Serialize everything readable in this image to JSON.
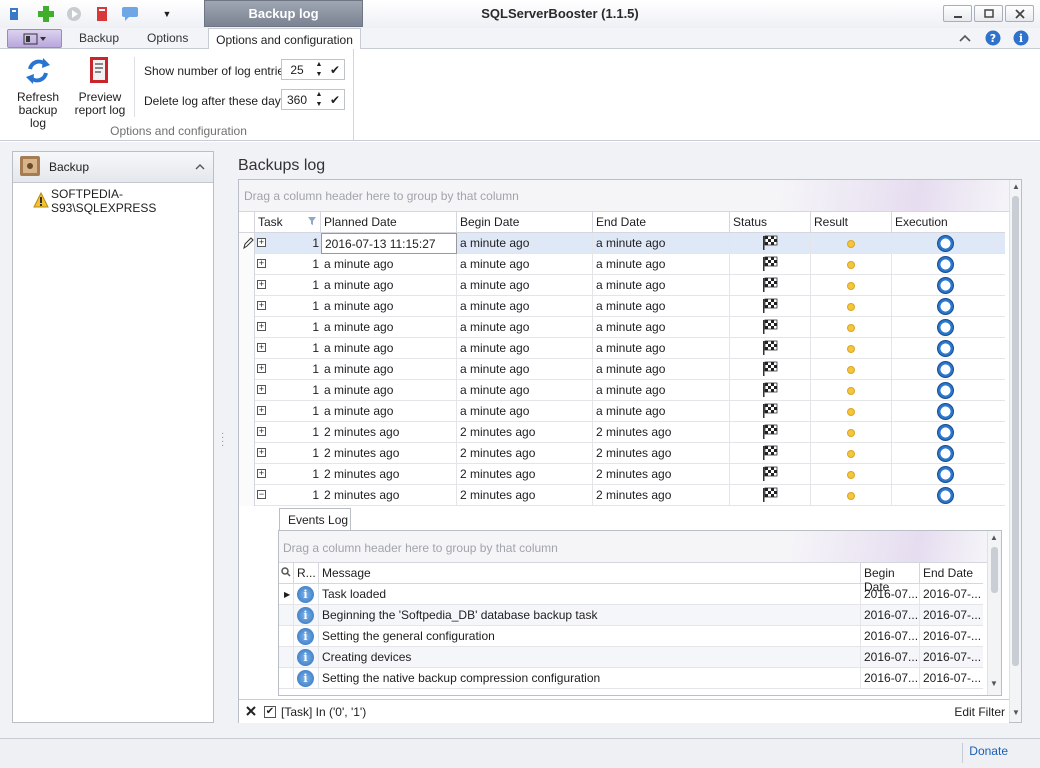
{
  "window": {
    "title": "SQLServerBooster (1.1.5)",
    "contextual_tab": "Backup log"
  },
  "ribbon": {
    "tabs": [
      "Backup",
      "Options"
    ],
    "active_tab": "Options and configuration",
    "buttons": {
      "refresh": "Refresh\nbackup log",
      "preview": "Preview\nreport log"
    },
    "log_entries_label": "Show number of log entries",
    "log_entries_value": "25",
    "delete_days_label": "Delete log after these days",
    "delete_days_value": "360",
    "group_caption": "Options and configuration"
  },
  "left_panel": {
    "header": "Backup",
    "tree_item": "SOFTPEDIA-S93\\SQLEXPRESS"
  },
  "backups_log": {
    "title": "Backups log",
    "group_hint": "Drag a column header here to group by that column",
    "columns": [
      "Task",
      "Planned Date",
      "Begin Date",
      "End Date",
      "Status",
      "Result",
      "Execution"
    ],
    "rows": [
      {
        "task": "1",
        "planned": "2016-07-13 11:15:27",
        "begin": "a minute ago",
        "end": "a minute ago"
      },
      {
        "task": "1",
        "planned": "a minute ago",
        "begin": "a minute ago",
        "end": "a minute ago"
      },
      {
        "task": "1",
        "planned": "a minute ago",
        "begin": "a minute ago",
        "end": "a minute ago"
      },
      {
        "task": "1",
        "planned": "a minute ago",
        "begin": "a minute ago",
        "end": "a minute ago"
      },
      {
        "task": "1",
        "planned": "a minute ago",
        "begin": "a minute ago",
        "end": "a minute ago"
      },
      {
        "task": "1",
        "planned": "a minute ago",
        "begin": "a minute ago",
        "end": "a minute ago"
      },
      {
        "task": "1",
        "planned": "a minute ago",
        "begin": "a minute ago",
        "end": "a minute ago"
      },
      {
        "task": "1",
        "planned": "a minute ago",
        "begin": "a minute ago",
        "end": "a minute ago"
      },
      {
        "task": "1",
        "planned": "a minute ago",
        "begin": "a minute ago",
        "end": "a minute ago"
      },
      {
        "task": "1",
        "planned": "2 minutes ago",
        "begin": "2 minutes ago",
        "end": "2 minutes ago"
      },
      {
        "task": "1",
        "planned": "2 minutes ago",
        "begin": "2 minutes ago",
        "end": "2 minutes ago"
      },
      {
        "task": "1",
        "planned": "2 minutes ago",
        "begin": "2 minutes ago",
        "end": "2 minutes ago"
      },
      {
        "task": "1",
        "planned": "2 minutes ago",
        "begin": "2 minutes ago",
        "end": "2 minutes ago"
      }
    ]
  },
  "events_log": {
    "tab": "Events Log",
    "group_hint": "Drag a column header here to group by that column",
    "columns": [
      "R...",
      "Message",
      "Begin Date",
      "End Date"
    ],
    "rows": [
      {
        "message": "Task loaded",
        "begin": "2016-07...",
        "end": "2016-07-..."
      },
      {
        "message": "Beginning the 'Softpedia_DB' database backup task",
        "begin": "2016-07...",
        "end": "2016-07-..."
      },
      {
        "message": "Setting the general configuration",
        "begin": "2016-07...",
        "end": "2016-07-..."
      },
      {
        "message": "Creating devices",
        "begin": "2016-07...",
        "end": "2016-07-..."
      },
      {
        "message": "Setting the native backup compression configuration",
        "begin": "2016-07...",
        "end": "2016-07-..."
      }
    ]
  },
  "filter": {
    "text": "[Task] In ('0', '1')",
    "edit_label": "Edit Filter"
  },
  "status": {
    "donate": "Donate"
  },
  "colors": {
    "accent": "#1b5fb5",
    "selected_row": "#dfe8f7",
    "result_dot": "#f4c53d"
  }
}
